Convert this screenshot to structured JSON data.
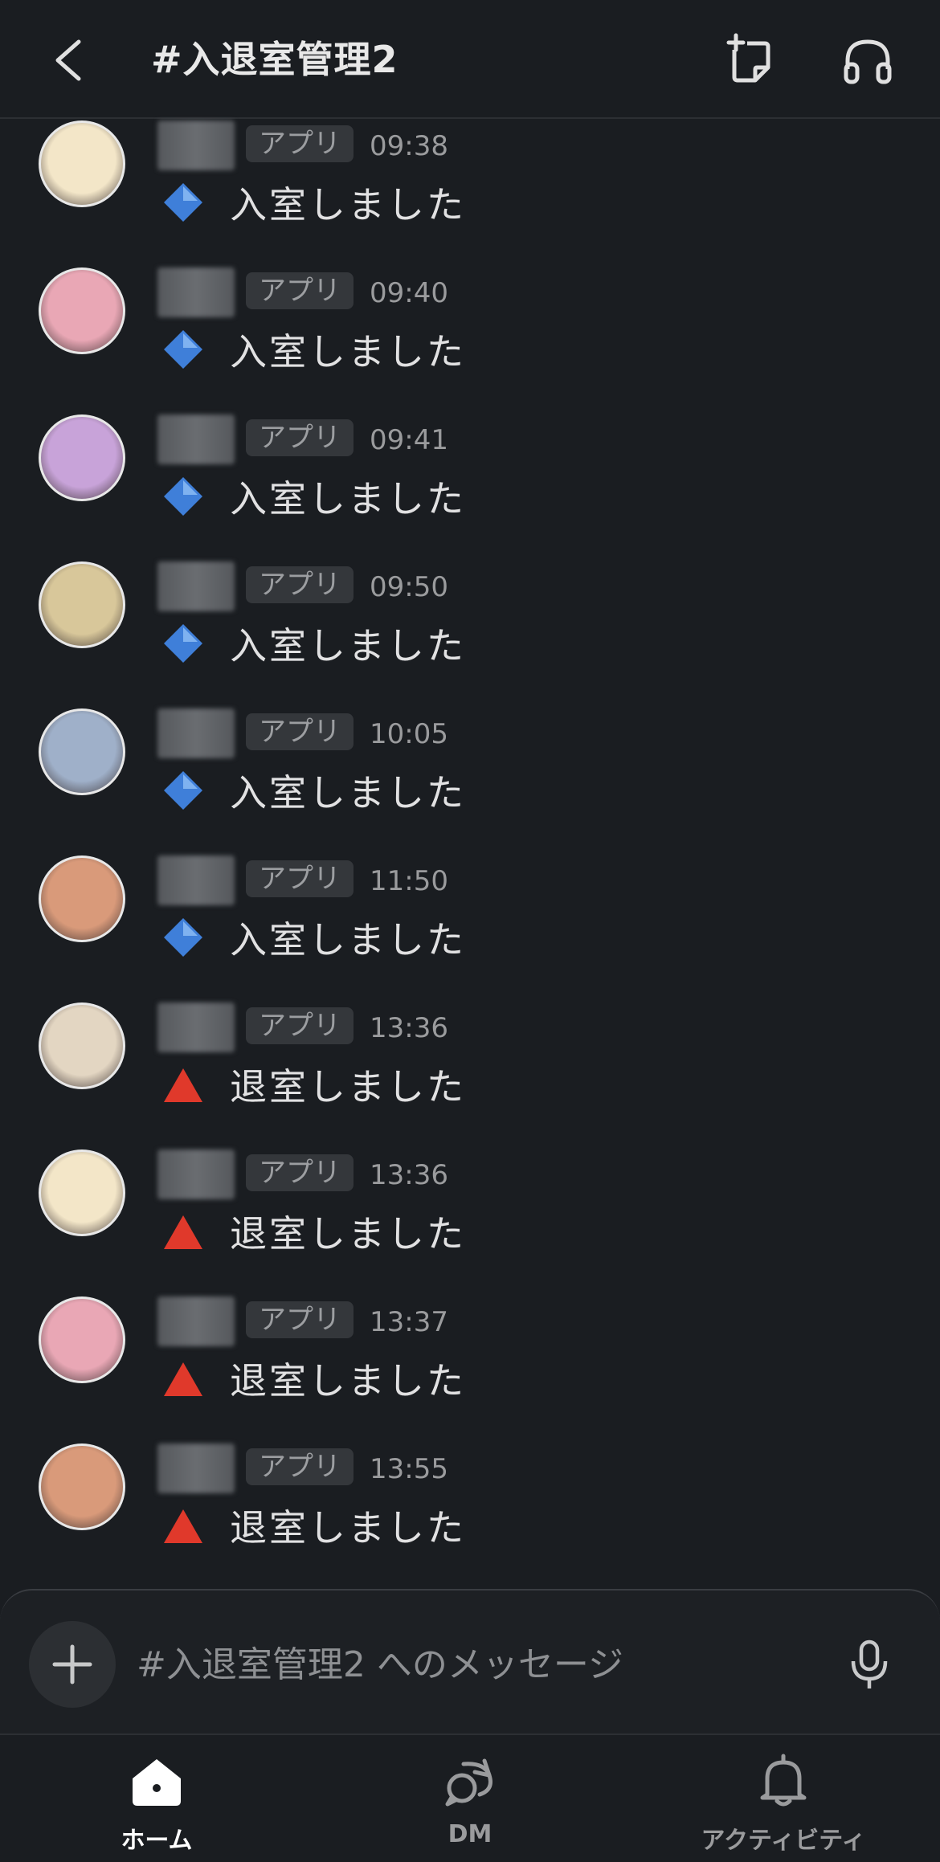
{
  "header": {
    "title": "#入退室管理2",
    "back_icon": "chevron-left-icon",
    "canvas_icon": "canvas-add-icon",
    "huddle_icon": "headphones-icon"
  },
  "messages": [
    {
      "badge": "アプリ",
      "time": "09:38",
      "icon": "blue-diamond-icon",
      "text": "入室しました",
      "avatar_color": "#f3e6c8"
    },
    {
      "badge": "アプリ",
      "time": "09:40",
      "icon": "blue-diamond-icon",
      "text": "入室しました",
      "avatar_color": "#e9a7b5"
    },
    {
      "badge": "アプリ",
      "time": "09:41",
      "icon": "blue-diamond-icon",
      "text": "入室しました",
      "avatar_color": "#c8a3d9"
    },
    {
      "badge": "アプリ",
      "time": "09:50",
      "icon": "blue-diamond-icon",
      "text": "入室しました",
      "avatar_color": "#d8c79a"
    },
    {
      "badge": "アプリ",
      "time": "10:05",
      "icon": "blue-diamond-icon",
      "text": "入室しました",
      "avatar_color": "#9fb0c9"
    },
    {
      "badge": "アプリ",
      "time": "11:50",
      "icon": "blue-diamond-icon",
      "text": "入室しました",
      "avatar_color": "#d99a7a"
    },
    {
      "badge": "アプリ",
      "time": "13:36",
      "icon": "red-triangle-icon",
      "text": "退室しました",
      "avatar_color": "#e3d6c2"
    },
    {
      "badge": "アプリ",
      "time": "13:36",
      "icon": "red-triangle-icon",
      "text": "退室しました",
      "avatar_color": "#f3e6c8"
    },
    {
      "badge": "アプリ",
      "time": "13:37",
      "icon": "red-triangle-icon",
      "text": "退室しました",
      "avatar_color": "#e9a7b5"
    },
    {
      "badge": "アプリ",
      "time": "13:55",
      "icon": "red-triangle-icon",
      "text": "退室しました",
      "avatar_color": "#d99a7a"
    }
  ],
  "composer": {
    "placeholder": "#入退室管理2 へのメッセージ",
    "plus_icon": "plus-icon",
    "mic_icon": "microphone-icon"
  },
  "nav": {
    "items": [
      {
        "label": "ホーム",
        "icon": "home-icon",
        "active": true
      },
      {
        "label": "DM",
        "icon": "dm-bubbles-icon",
        "active": false
      },
      {
        "label": "アクティビティ",
        "icon": "bell-icon",
        "active": false
      }
    ]
  },
  "colors": {
    "background": "#1a1d21",
    "badge_bg": "#34373b",
    "enter_icon": "#3f7fd9",
    "exit_icon": "#e0392b"
  }
}
